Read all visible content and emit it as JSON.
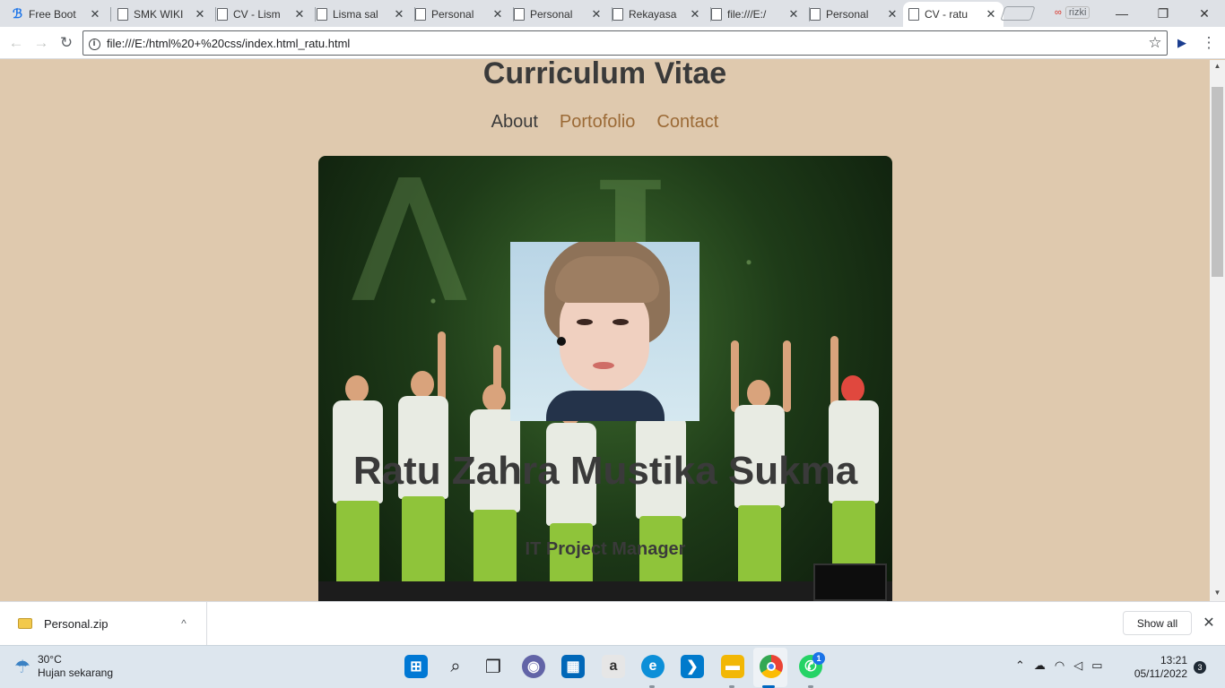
{
  "browser": {
    "tabs": [
      {
        "title": "Free Boot",
        "active": false
      },
      {
        "title": "SMK WIKI",
        "active": false
      },
      {
        "title": "CV - Lism",
        "active": false
      },
      {
        "title": "Lisma sal",
        "active": false
      },
      {
        "title": "Personal",
        "active": false
      },
      {
        "title": "Personal",
        "active": false
      },
      {
        "title": "Rekayasa",
        "active": false
      },
      {
        "title": "file:///E:/",
        "active": false
      },
      {
        "title": "Personal",
        "active": false
      },
      {
        "title": "CV - ratu",
        "active": true
      }
    ],
    "profile_name": "rizki",
    "window_controls": {
      "minimize": "—",
      "restore": "❐",
      "close": "✕"
    },
    "address": {
      "url": "file:///E:/html%20+%20css/index.html_ratu.html"
    },
    "nav_icons": {
      "back": "←",
      "forward": "→",
      "reload": "↻",
      "info": "i",
      "star": "☆",
      "menu": "⋮",
      "extension": "▶"
    }
  },
  "page": {
    "title": "Curriculum Vitae",
    "nav": [
      {
        "label": "About",
        "current": true
      },
      {
        "label": "Portofolio",
        "current": false
      },
      {
        "label": "Contact",
        "current": false
      }
    ],
    "hero": {
      "name": "Ratu Zahra Mustika Sukma",
      "role": "IT Project Manager"
    },
    "colors": {
      "background": "#dfc9ae",
      "heading": "#3a3a3a",
      "link": "#9b6a36"
    }
  },
  "downloads": {
    "item": {
      "filename": "Personal.zip",
      "chevron": "^"
    },
    "show_all": "Show all",
    "close": "✕"
  },
  "taskbar": {
    "weather": {
      "temperature": "30°C",
      "condition": "Hujan sekarang"
    },
    "apps": [
      {
        "name": "start-menu",
        "glyph": "⊞",
        "color": "#0078d4"
      },
      {
        "name": "search",
        "glyph": "⌕",
        "color": "#202124"
      },
      {
        "name": "task-view",
        "glyph": "❐",
        "color": "#202124"
      },
      {
        "name": "chat",
        "glyph": "◉",
        "color": "#6264a7"
      },
      {
        "name": "store",
        "glyph": "▦",
        "color": "#0067b8"
      },
      {
        "name": "amazon",
        "glyph": "a",
        "color": "#6b6b6b"
      },
      {
        "name": "edge",
        "glyph": "e",
        "color": "#0c8fd8"
      },
      {
        "name": "vscode",
        "glyph": "✕",
        "color": "#007acc"
      },
      {
        "name": "file-explorer",
        "glyph": "▬",
        "color": "#f2b705"
      },
      {
        "name": "chrome",
        "glyph": "●",
        "color": "#34a853"
      },
      {
        "name": "whatsapp",
        "glyph": "✆",
        "color": "#25d366"
      }
    ],
    "whatsapp_badge": "1",
    "tray_icons": [
      "^",
      "☁",
      "wifi",
      "volume",
      "battery"
    ],
    "clock": {
      "time": "13:21",
      "date": "05/11/2022"
    },
    "notifications": "3"
  }
}
